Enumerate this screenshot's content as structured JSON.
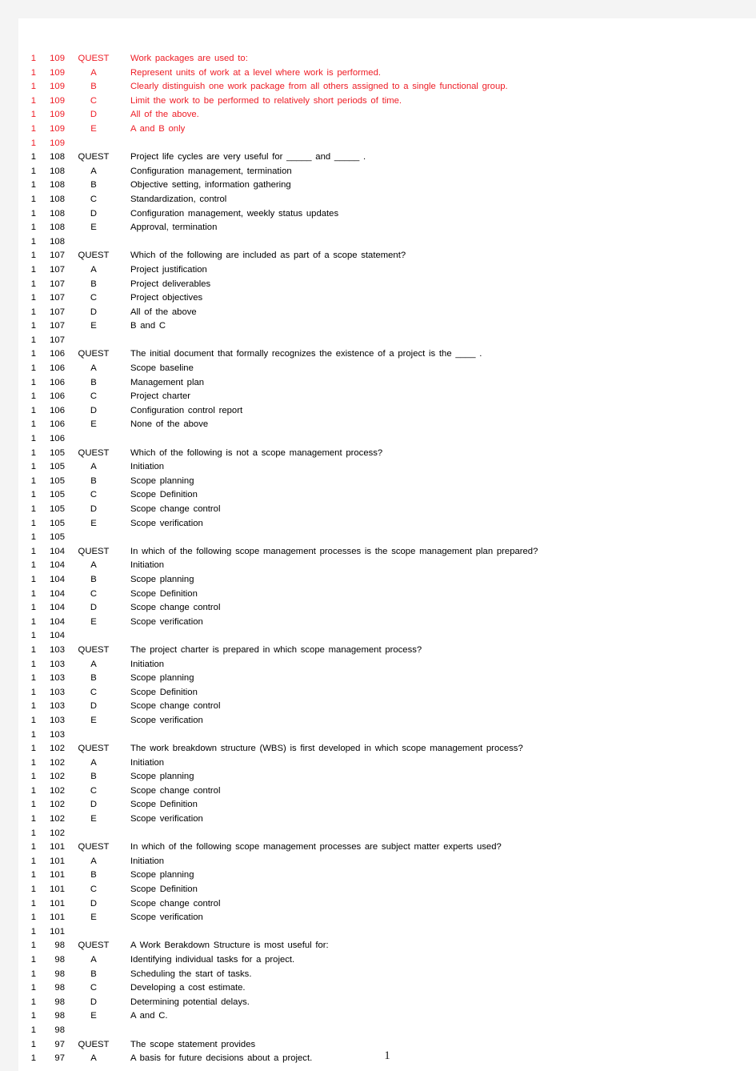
{
  "page": {
    "page_number": "1",
    "columns": [
      "section",
      "question_number",
      "key",
      "text"
    ],
    "colors": {
      "highlight_red": "#ee1c25",
      "body_black": "#000000",
      "page_background": "#ffffff",
      "canvas_background": "#f4f4f4"
    }
  },
  "rows": [
    {
      "section": "1",
      "number": "109",
      "key": "QUEST",
      "text": "Work packages are used to:",
      "color": "red"
    },
    {
      "section": "1",
      "number": "109",
      "key": "A",
      "text": "Represent units of work at a level where work is performed.",
      "color": "red"
    },
    {
      "section": "1",
      "number": "109",
      "key": "B",
      "text": "Clearly distinguish one work package from all others assigned to a single functional group.",
      "color": "red"
    },
    {
      "section": "1",
      "number": "109",
      "key": "C",
      "text": "Limit the work to be performed to relatively short periods of time.",
      "color": "red"
    },
    {
      "section": "1",
      "number": "109",
      "key": "D",
      "text": "All of the above.",
      "color": "red"
    },
    {
      "section": "1",
      "number": "109",
      "key": "E",
      "text": "A and B only",
      "color": "red"
    },
    {
      "section": "1",
      "number": "109",
      "key": "",
      "text": "",
      "color": "red"
    },
    {
      "section": "1",
      "number": "108",
      "key": "QUEST",
      "text": "Project life cycles are very useful for _____ and _____ .",
      "color": "black"
    },
    {
      "section": "1",
      "number": "108",
      "key": "A",
      "text": "Configuration management, termination",
      "color": "black"
    },
    {
      "section": "1",
      "number": "108",
      "key": "B",
      "text": "Objective setting, information gathering",
      "color": "black"
    },
    {
      "section": "1",
      "number": "108",
      "key": "C",
      "text": "Standardization, control",
      "color": "black"
    },
    {
      "section": "1",
      "number": "108",
      "key": "D",
      "text": "Configuration management, weekly status updates",
      "color": "black"
    },
    {
      "section": "1",
      "number": "108",
      "key": "E",
      "text": "Approval, termination",
      "color": "black"
    },
    {
      "section": "1",
      "number": "108",
      "key": "",
      "text": "",
      "color": "black"
    },
    {
      "section": "1",
      "number": "107",
      "key": "QUEST",
      "text": "Which of the following are included as part of a scope statement?",
      "color": "black"
    },
    {
      "section": "1",
      "number": "107",
      "key": "A",
      "text": "Project justification",
      "color": "black"
    },
    {
      "section": "1",
      "number": "107",
      "key": "B",
      "text": "Project deliverables",
      "color": "black"
    },
    {
      "section": "1",
      "number": "107",
      "key": "C",
      "text": "Project objectives",
      "color": "black"
    },
    {
      "section": "1",
      "number": "107",
      "key": "D",
      "text": "All of the above",
      "color": "black"
    },
    {
      "section": "1",
      "number": "107",
      "key": "E",
      "text": "B and C",
      "color": "black"
    },
    {
      "section": "1",
      "number": "107",
      "key": "",
      "text": "",
      "color": "black"
    },
    {
      "section": "1",
      "number": "106",
      "key": "QUEST",
      "text": "The initial document that formally recognizes the existence of a project is the ____ .",
      "color": "black"
    },
    {
      "section": "1",
      "number": "106",
      "key": "A",
      "text": "Scope baseline",
      "color": "black"
    },
    {
      "section": "1",
      "number": "106",
      "key": "B",
      "text": "Management plan",
      "color": "black"
    },
    {
      "section": "1",
      "number": "106",
      "key": "C",
      "text": "Project charter",
      "color": "black"
    },
    {
      "section": "1",
      "number": "106",
      "key": "D",
      "text": "Configuration control report",
      "color": "black"
    },
    {
      "section": "1",
      "number": "106",
      "key": "E",
      "text": "None of the above",
      "color": "black"
    },
    {
      "section": "1",
      "number": "106",
      "key": "",
      "text": "",
      "color": "black"
    },
    {
      "section": "1",
      "number": "105",
      "key": "QUEST",
      "text": "Which of the following is not a scope management process?",
      "color": "black"
    },
    {
      "section": "1",
      "number": "105",
      "key": "A",
      "text": "Initiation",
      "color": "black"
    },
    {
      "section": "1",
      "number": "105",
      "key": "B",
      "text": "Scope planning",
      "color": "black"
    },
    {
      "section": "1",
      "number": "105",
      "key": "C",
      "text": "Scope Definition",
      "color": "black"
    },
    {
      "section": "1",
      "number": "105",
      "key": "D",
      "text": "Scope change control",
      "color": "black"
    },
    {
      "section": "1",
      "number": "105",
      "key": "E",
      "text": "Scope verification",
      "color": "black"
    },
    {
      "section": "1",
      "number": "105",
      "key": "",
      "text": "",
      "color": "black"
    },
    {
      "section": "1",
      "number": "104",
      "key": "QUEST",
      "text": "In which of the following scope management processes is the scope management plan prepared?",
      "color": "black"
    },
    {
      "section": "1",
      "number": "104",
      "key": "A",
      "text": "Initiation",
      "color": "black"
    },
    {
      "section": "1",
      "number": "104",
      "key": "B",
      "text": "Scope planning",
      "color": "black"
    },
    {
      "section": "1",
      "number": "104",
      "key": "C",
      "text": "Scope Definition",
      "color": "black"
    },
    {
      "section": "1",
      "number": "104",
      "key": "D",
      "text": "Scope change control",
      "color": "black"
    },
    {
      "section": "1",
      "number": "104",
      "key": "E",
      "text": "Scope verification",
      "color": "black"
    },
    {
      "section": "1",
      "number": "104",
      "key": "",
      "text": "",
      "color": "black"
    },
    {
      "section": "1",
      "number": "103",
      "key": "QUEST",
      "text": "The project charter is prepared in which scope management process?",
      "color": "black"
    },
    {
      "section": "1",
      "number": "103",
      "key": "A",
      "text": "Initiation",
      "color": "black"
    },
    {
      "section": "1",
      "number": "103",
      "key": "B",
      "text": "Scope planning",
      "color": "black"
    },
    {
      "section": "1",
      "number": "103",
      "key": "C",
      "text": "Scope Definition",
      "color": "black"
    },
    {
      "section": "1",
      "number": "103",
      "key": "D",
      "text": "Scope change control",
      "color": "black"
    },
    {
      "section": "1",
      "number": "103",
      "key": "E",
      "text": "Scope verification",
      "color": "black"
    },
    {
      "section": "1",
      "number": "103",
      "key": "",
      "text": "",
      "color": "black"
    },
    {
      "section": "1",
      "number": "102",
      "key": "QUEST",
      "text": "The work breakdown structure (WBS) is first developed in which scope management process?",
      "color": "black"
    },
    {
      "section": "1",
      "number": "102",
      "key": "A",
      "text": "Initiation",
      "color": "black"
    },
    {
      "section": "1",
      "number": "102",
      "key": "B",
      "text": "Scope planning",
      "color": "black"
    },
    {
      "section": "1",
      "number": "102",
      "key": "C",
      "text": "Scope change control",
      "color": "black"
    },
    {
      "section": "1",
      "number": "102",
      "key": "D",
      "text": "Scope Definition",
      "color": "black"
    },
    {
      "section": "1",
      "number": "102",
      "key": "E",
      "text": "Scope verification",
      "color": "black"
    },
    {
      "section": "1",
      "number": "102",
      "key": "",
      "text": "",
      "color": "black"
    },
    {
      "section": "1",
      "number": "101",
      "key": "QUEST",
      "text": "In which of the following scope management processes are subject matter experts used?",
      "color": "black"
    },
    {
      "section": "1",
      "number": "101",
      "key": "A",
      "text": "Initiation",
      "color": "black"
    },
    {
      "section": "1",
      "number": "101",
      "key": "B",
      "text": "Scope planning",
      "color": "black"
    },
    {
      "section": "1",
      "number": "101",
      "key": "C",
      "text": "Scope Definition",
      "color": "black"
    },
    {
      "section": "1",
      "number": "101",
      "key": "D",
      "text": "Scope change control",
      "color": "black"
    },
    {
      "section": "1",
      "number": "101",
      "key": "E",
      "text": "Scope verification",
      "color": "black"
    },
    {
      "section": "1",
      "number": "101",
      "key": "",
      "text": "",
      "color": "black"
    },
    {
      "section": "1",
      "number": "98",
      "key": "QUEST",
      "text": "A Work Berakdown Structure is most useful for:",
      "color": "black"
    },
    {
      "section": "1",
      "number": "98",
      "key": "A",
      "text": "Identifying individual tasks for a project.",
      "color": "black"
    },
    {
      "section": "1",
      "number": "98",
      "key": "B",
      "text": "Scheduling the start of tasks.",
      "color": "black"
    },
    {
      "section": "1",
      "number": "98",
      "key": "C",
      "text": "Developing a cost estimate.",
      "color": "black"
    },
    {
      "section": "1",
      "number": "98",
      "key": "D",
      "text": "Determining potential delays.",
      "color": "black"
    },
    {
      "section": "1",
      "number": "98",
      "key": "E",
      "text": "A and C.",
      "color": "black"
    },
    {
      "section": "1",
      "number": "98",
      "key": "",
      "text": "",
      "color": "black"
    },
    {
      "section": "1",
      "number": "97",
      "key": "QUEST",
      "text": "The scope statement provides",
      "color": "black"
    },
    {
      "section": "1",
      "number": "97",
      "key": "A",
      "text": "A basis for future decisions about a project.",
      "color": "black"
    }
  ]
}
